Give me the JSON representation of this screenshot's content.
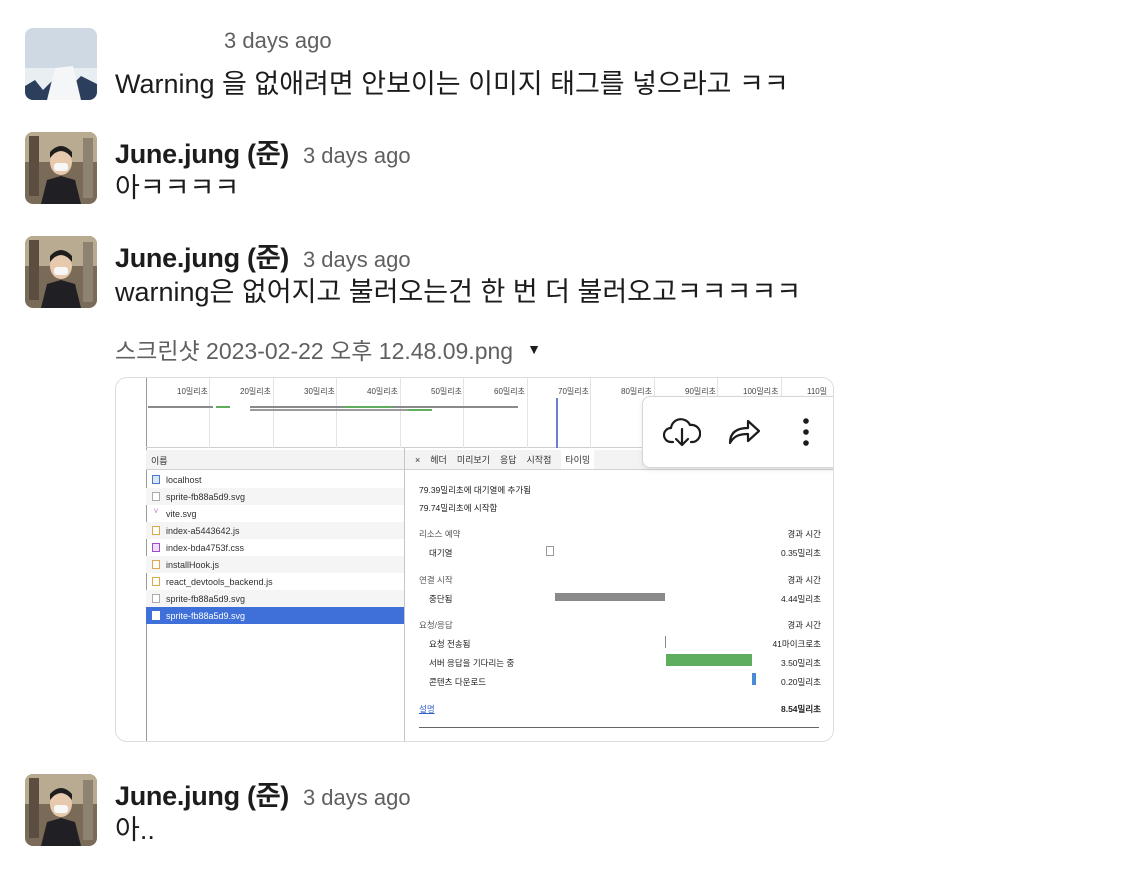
{
  "messages": [
    {
      "author": "",
      "time": "3 days ago",
      "text": "Warning 을 없애려면 안보이는 이미지 태그를 넣으라고 ㅋㅋ"
    },
    {
      "author": "June.jung (준)",
      "time": "3 days ago",
      "text": "아ㅋㅋㅋㅋ"
    },
    {
      "author": "June.jung (준)",
      "time": "3 days ago",
      "text": "warning은 없어지고 불러오는건 한 번 더 불러오고ㅋㅋㅋㅋㅋ",
      "attachment": {
        "filename": "스크린샷 2023-02-22 오후 12.48.09.png",
        "actions": [
          "download-icon",
          "share-icon",
          "more-icon"
        ],
        "screenshot": {
          "ticks": [
            "10밀리초",
            "20밀리초",
            "30밀리초",
            "40밀리초",
            "50밀리초",
            "60밀리초",
            "70밀리초",
            "80밀리초",
            "90밀리초",
            "100밀리초",
            "110밀"
          ],
          "name_header": "이름",
          "files": [
            {
              "name": "localhost",
              "icon": "doc"
            },
            {
              "name": "sprite-fb88a5d9.svg",
              "icon": "blank"
            },
            {
              "name": "vite.svg",
              "icon": "svg"
            },
            {
              "name": "index-a5443642.js",
              "icon": "js"
            },
            {
              "name": "index-bda4753f.css",
              "icon": "css"
            },
            {
              "name": "installHook.js",
              "icon": "js"
            },
            {
              "name": "react_devtools_backend.js",
              "icon": "js"
            },
            {
              "name": "sprite-fb88a5d9.svg",
              "icon": "blank"
            },
            {
              "name": "sprite-fb88a5d9.svg",
              "icon": "blank",
              "selected": true
            }
          ],
          "tabs": [
            "×",
            "헤더",
            "미리보기",
            "응답",
            "시작점",
            "타이밍"
          ],
          "detail": {
            "queued": "79.39밀리초에 대기열에 추가됨",
            "started": "79.74밀리초에 시작함",
            "sections": [
              {
                "title": "리소스 예약",
                "duration_header": "경과 시간",
                "rows": [
                  {
                    "label": "대기열",
                    "value": "0.35밀리초"
                  }
                ]
              },
              {
                "title": "연결 시작",
                "duration_header": "경과 시간",
                "rows": [
                  {
                    "label": "중단됨",
                    "value": "4.44밀리초"
                  }
                ]
              },
              {
                "title": "요청/응답",
                "duration_header": "경과 시간",
                "rows": [
                  {
                    "label": "요청 전송됨",
                    "value": "41마이크로초"
                  },
                  {
                    "label": "서버 응답을 기다리는 중",
                    "value": "3.50밀리초"
                  },
                  {
                    "label": "콘텐츠 다운로드",
                    "value": "0.20밀리초"
                  }
                ]
              }
            ],
            "explain_link": "설명",
            "total": "8.54밀리초"
          }
        }
      }
    },
    {
      "author": "June.jung (준)",
      "time": "3 days ago",
      "text": "아.."
    }
  ],
  "colors": {
    "text": "#1d1c1d",
    "muted": "#616061",
    "selected_row": "#3f6fd8",
    "bar_gray": "#8a8a8a",
    "bar_green": "#5fae5f",
    "bar_blue": "#4a8bd6"
  }
}
